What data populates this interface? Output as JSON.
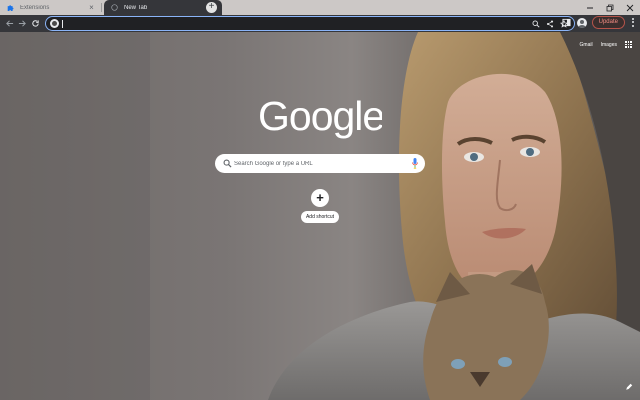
{
  "tabs": [
    {
      "title": "Extensions",
      "favicon": "puzzle-icon"
    },
    {
      "title": "New Tab",
      "favicon": "newtab-icon",
      "active": true
    }
  ],
  "toolbar": {
    "omnibox_placeholder": "",
    "update_label": "Update"
  },
  "ntp": {
    "top_links": {
      "gmail": "Gmail",
      "images": "Images"
    },
    "logo_text": "Google",
    "search_placeholder": "Search Google or type a URL",
    "shortcut_label": "Add shortcut",
    "shortcut_icon": "+"
  },
  "colors": {
    "accent": "#8ab4f8",
    "update": "#f28b82",
    "toolbar": "#35363a",
    "tabstrip": "#ccc8c6"
  }
}
